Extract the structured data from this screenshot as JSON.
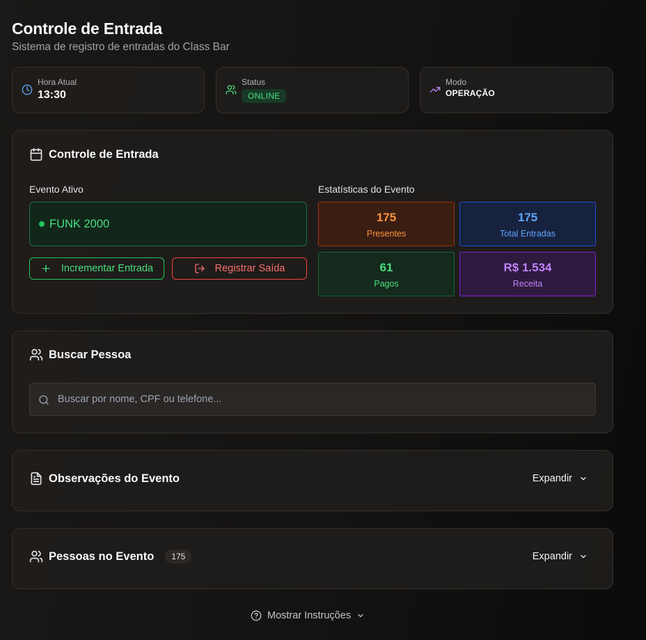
{
  "header": {
    "title": "Controle de Entrada",
    "subtitle": "Sistema de registro de entradas do Class Bar"
  },
  "info_cards": {
    "time": {
      "label": "Hora Atual",
      "value": "13:30",
      "icon": "clock-icon"
    },
    "status": {
      "label": "Status",
      "value": "ONLINE",
      "icon": "users-icon"
    },
    "mode": {
      "label": "Modo",
      "value": "OPERAÇÃO",
      "icon": "trending-up-icon"
    }
  },
  "entry_control": {
    "title": "Controle de Entrada",
    "active_event_label": "Evento Ativo",
    "active_event_name": "FUNK 2000",
    "increment_button": "Incrementar Entrada",
    "exit_button": "Registrar Saída",
    "stats_label": "Estatísticas do Evento",
    "stats": {
      "present": {
        "value": "175",
        "label": "Presentes"
      },
      "total": {
        "value": "175",
        "label": "Total Entradas"
      },
      "paid": {
        "value": "61",
        "label": "Pagos"
      },
      "revenue": {
        "value": "R$ 1.534",
        "label": "Receita"
      }
    }
  },
  "search": {
    "title": "Buscar Pessoa",
    "placeholder": "Buscar por nome, CPF ou telefone..."
  },
  "notes": {
    "title": "Observações do Evento",
    "expand_label": "Expandir"
  },
  "people": {
    "title": "Pessoas no Evento",
    "count": "175",
    "expand_label": "Expandir"
  },
  "footer": {
    "instructions_label": "Mostrar Instruções"
  },
  "colors": {
    "green": "#4ade80",
    "red": "#f87171",
    "orange": "#fb923c",
    "blue": "#60a5fa",
    "purple": "#c084fc"
  }
}
